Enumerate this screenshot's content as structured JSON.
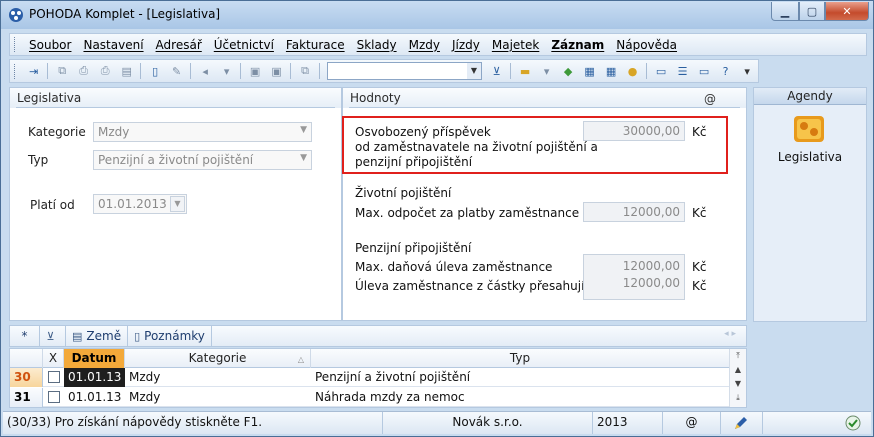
{
  "window": {
    "title": "POHODA Komplet - [Legislativa]",
    "close_color": "#c44b2c"
  },
  "menu": {
    "items": [
      "Soubor",
      "Nastavení",
      "Adresář",
      "Účetnictví",
      "Fakturace",
      "Sklady",
      "Mzdy",
      "Jízdy",
      "Majetek",
      "Záznam",
      "Nápověda"
    ]
  },
  "toolbar": {
    "icons": [
      "agenda-icon",
      "copy-icon",
      "print-preview-icon",
      "print-icon",
      "export-icon",
      "new-record-icon",
      "edit-icon",
      "back-arrow-icon",
      "save-icon",
      "cancel-save-icon",
      "duplicate-icon",
      "filter-icon",
      "folder-icon",
      "money-icon",
      "calculator-icon",
      "table-icon",
      "coins-icon",
      "message-icon",
      "list-icon",
      "notes-icon",
      "help-icon"
    ],
    "search_value": ""
  },
  "legislativa": {
    "header": "Legislativa",
    "kategorie_label": "Kategorie",
    "kategorie_value": "Mzdy",
    "typ_label": "Typ",
    "typ_value": "Penzijní a životní pojištění",
    "plati_od_label": "Platí od",
    "plati_od_value": "01.01.2013"
  },
  "hodnoty": {
    "header": "Hodnoty",
    "at_sign": "@",
    "osvobozeny_line1": "Osvobozený příspěvek",
    "osvobozeny_line2": "od zaměstnavatele na životní pojištění a",
    "osvobozeny_line3": "penzijní připojištění",
    "osvobozeny_value": "30000,00",
    "zivotni_heading": "Životní pojištění",
    "zivotni_label": "Max. odpočet za platby zaměstnance",
    "zivotni_value": "12000,00",
    "penzijni_heading": "Penzijní připojištění",
    "penzijni_label1": "Max. daňová úleva zaměstnance",
    "penzijni_value1": "12000,00",
    "penzijni_label2": "Úleva zaměstnance z částky přesahující",
    "penzijni_value2": "12000,00",
    "currency": "Kč",
    "highlight_color": "#e0201c"
  },
  "agenda": {
    "header": "Agendy",
    "label": "Legislativa"
  },
  "tabs": {
    "star": "*",
    "items": [
      "Země",
      "Poznámky"
    ]
  },
  "table": {
    "columns": [
      "X",
      "Datum",
      "Kategorie",
      "Typ"
    ],
    "rows": [
      {
        "num": "30",
        "datum": "01.01.13",
        "kategorie": "Mzdy",
        "typ": "Penzijní a životní pojištění"
      },
      {
        "num": "31",
        "datum": "01.01.13",
        "kategorie": "Mzdy",
        "typ": "Náhrada mzdy za nemoc"
      }
    ]
  },
  "status": {
    "help_text": "(30/33) Pro získání nápovědy stiskněte F1.",
    "company": "Novák  s.r.o.",
    "year": "2013",
    "at": "@"
  }
}
